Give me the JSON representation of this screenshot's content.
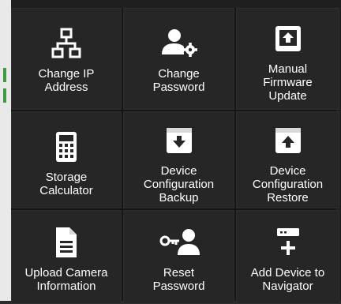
{
  "tiles": [
    {
      "id": "change-ip-address",
      "label": "Change IP\nAddress",
      "icon": "network-icon"
    },
    {
      "id": "change-password",
      "label": "Change\nPassword",
      "icon": "user-gear-icon"
    },
    {
      "id": "manual-firmware-update",
      "label": "Manual\nFirmware\nUpdate",
      "icon": "firmware-upload-icon"
    },
    {
      "id": "storage-calculator",
      "label": "Storage\nCalculator",
      "icon": "calculator-icon"
    },
    {
      "id": "device-configuration-backup",
      "label": "Device\nConfiguration\nBackup",
      "icon": "box-download-icon"
    },
    {
      "id": "device-configuration-restore",
      "label": "Device\nConfiguration\nRestore",
      "icon": "box-upload-icon"
    },
    {
      "id": "upload-camera-information",
      "label": "Upload Camera\nInformation",
      "icon": "document-icon"
    },
    {
      "id": "reset-password",
      "label": "Reset\nPassword",
      "icon": "key-user-icon"
    },
    {
      "id": "add-device-to-navigator",
      "label": "Add Device to\nNavigator",
      "icon": "device-add-icon"
    }
  ],
  "colors": {
    "tile_bg": "#262626",
    "text": "#ffffff",
    "border": "#141414",
    "accent_green": "#3f9b3f"
  }
}
